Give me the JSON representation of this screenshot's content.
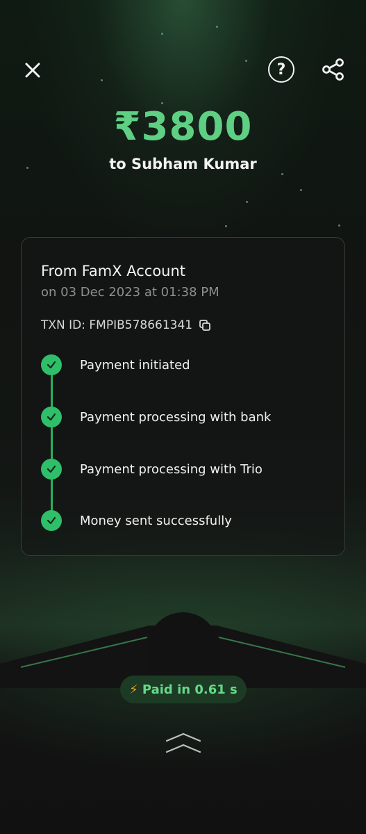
{
  "header": {
    "close_icon": "close-icon",
    "help_label": "?",
    "share_icon": "share-icon"
  },
  "payment": {
    "amount": "₹3800",
    "recipient": "to Subham Kumar"
  },
  "details": {
    "from": "From FamX Account",
    "date": "on 03 Dec 2023 at 01:38 PM",
    "txn_id": "TXN ID: FMPIB578661341",
    "copy_icon": "copy-icon"
  },
  "steps": [
    {
      "label": "Payment initiated"
    },
    {
      "label": "Payment processing with bank"
    },
    {
      "label": "Payment processing with Trio"
    },
    {
      "label": "Money sent successfully"
    }
  ],
  "badge": {
    "text": "Paid in 0.61 s",
    "icon": "lightning-icon"
  },
  "footer": {
    "icon": "chevron-up-icon"
  },
  "colors": {
    "accent_green": "#5fcf84",
    "check_green": "#2fbf6a",
    "bolt_orange": "#f0a01f",
    "background": "#121312"
  }
}
